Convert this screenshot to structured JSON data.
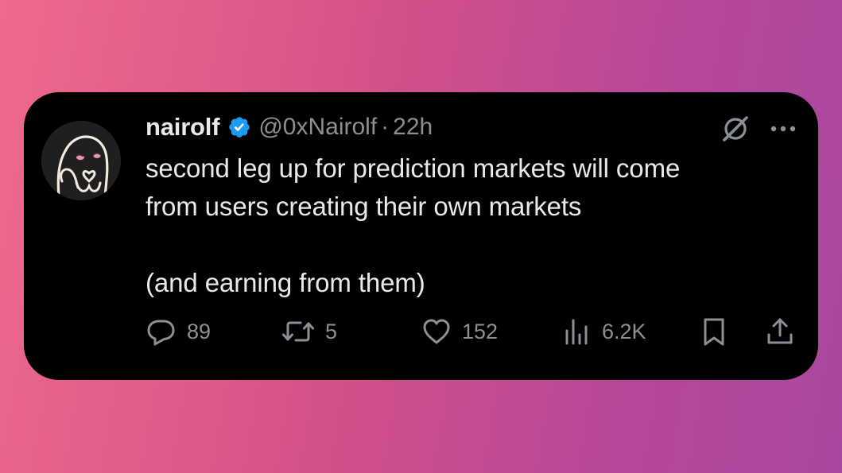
{
  "tweet": {
    "author": {
      "display_name": "nairolf",
      "handle": "@0xNairolf",
      "verified": true,
      "avatar": "ghost-character-avatar"
    },
    "separator": "·",
    "timestamp": "22h",
    "text_lines": [
      "second leg up for prediction markets will come",
      "from users creating their own markets",
      "(and earning from them)"
    ],
    "metrics": {
      "replies": "89",
      "reposts": "5",
      "likes": "152",
      "views": "6.2K"
    }
  },
  "icons": {
    "verified": "verified-badge-icon",
    "grok": "grok-icon",
    "more": "more-icon",
    "reply": "reply-icon",
    "repost": "repost-icon",
    "like": "heart-icon",
    "views": "views-icon",
    "bookmark": "bookmark-icon",
    "share": "share-icon"
  },
  "colors": {
    "card_background": "#000000",
    "primary_text": "#e7e9ea",
    "secondary_text": "#8b9096",
    "verified_blue": "#1d9bf0",
    "background_gradient_start": "#ee6a8c",
    "background_gradient_end": "#a9489f"
  }
}
